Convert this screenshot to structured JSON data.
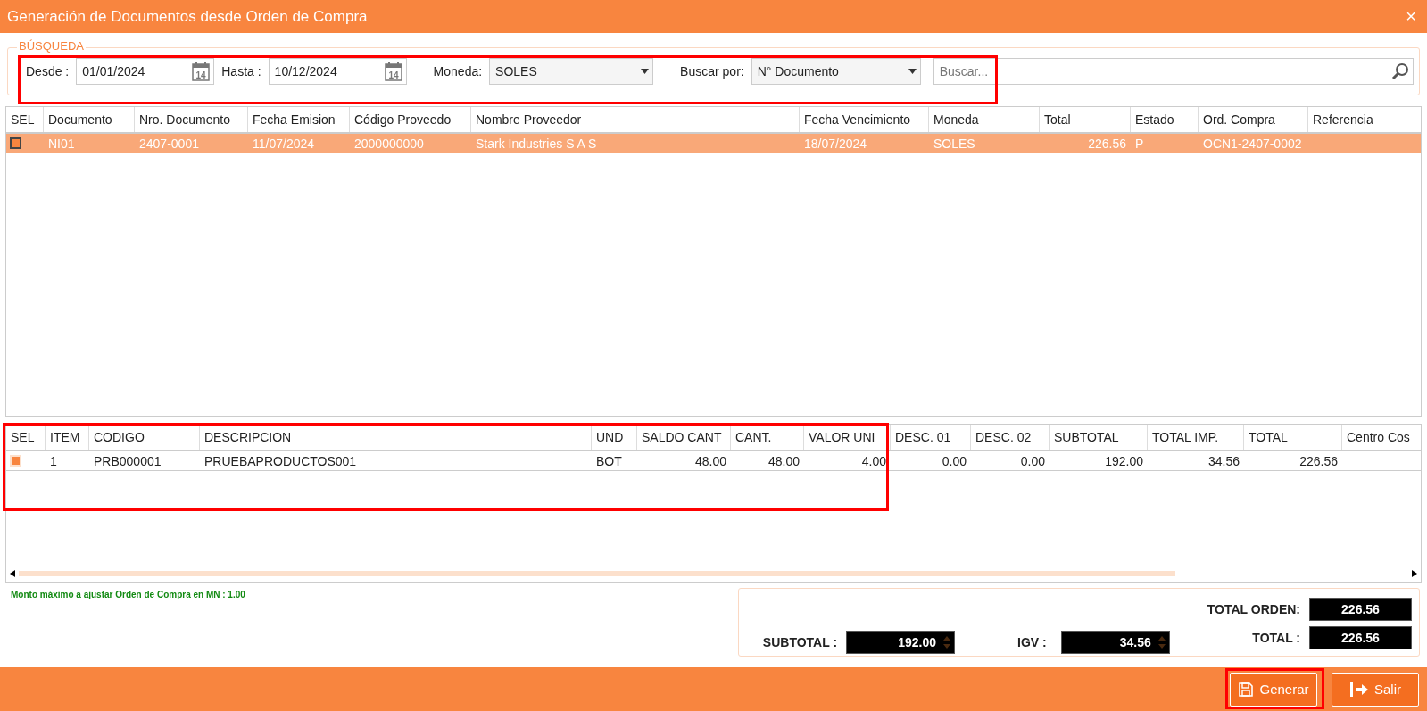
{
  "window": {
    "title": "Generación de Documentos desde Orden de Compra",
    "close": "×"
  },
  "search": {
    "legend": "BÚSQUEDA",
    "from_label": "Desde :",
    "from_value": "01/01/2024",
    "to_label": "Hasta :",
    "to_value": "10/12/2024",
    "from_calendar_day": "14",
    "to_calendar_day": "14",
    "currency_label": "Moneda:",
    "currency_value": "SOLES",
    "search_by_label": "Buscar por:",
    "search_by_value": "N° Documento",
    "placeholder": "Buscar..."
  },
  "orders_table": {
    "columns": [
      "SEL",
      "Documento",
      "Nro. Documento",
      "Fecha Emision",
      "Código Proveedo",
      "Nombre Proveedor",
      "Fecha Vencimiento",
      "Moneda",
      "Total",
      "Estado",
      "Ord. Compra",
      "Referencia"
    ],
    "rows": [
      {
        "selected": true,
        "checked": true,
        "cells": [
          "",
          "NI01",
          "2407-0001",
          "11/07/2024",
          "2000000000",
          "Stark Industries S A S",
          "18/07/2024",
          "SOLES",
          "226.56",
          "P",
          "OCN1-2407-0002"
        ]
      }
    ]
  },
  "detail_table": {
    "columns": [
      "SEL",
      "ITEM",
      "CODIGO",
      "DESCRIPCION",
      "UND",
      "SALDO CANT",
      "CANT.",
      "VALOR UNI",
      "DESC. 01",
      "DESC. 02",
      "SUBTOTAL",
      "TOTAL IMP.",
      "TOTAL",
      "Centro Cos"
    ],
    "rows": [
      {
        "selected": false,
        "checked": true,
        "cells": [
          "",
          "1",
          "PRB000001",
          "PRUEBAPRODUCTOS001",
          "BOT",
          "48.00",
          "48.00",
          "4.00",
          "0.00",
          "0.00",
          "192.00",
          "34.56",
          "226.56"
        ]
      }
    ]
  },
  "note": "Monto máximo a ajustar Orden de Compra en MN : 1.00",
  "totals": {
    "order_total_label": "TOTAL ORDEN:",
    "order_total": "226.56",
    "subtotal_label": "SUBTOTAL :",
    "subtotal": "192.00",
    "igv_label": "IGV :",
    "igv": "34.56",
    "total_label": "TOTAL :",
    "total": "226.56"
  },
  "buttons": [
    {
      "kind": "save",
      "label": "Generar"
    },
    {
      "kind": "exit",
      "label": "Salir"
    }
  ]
}
